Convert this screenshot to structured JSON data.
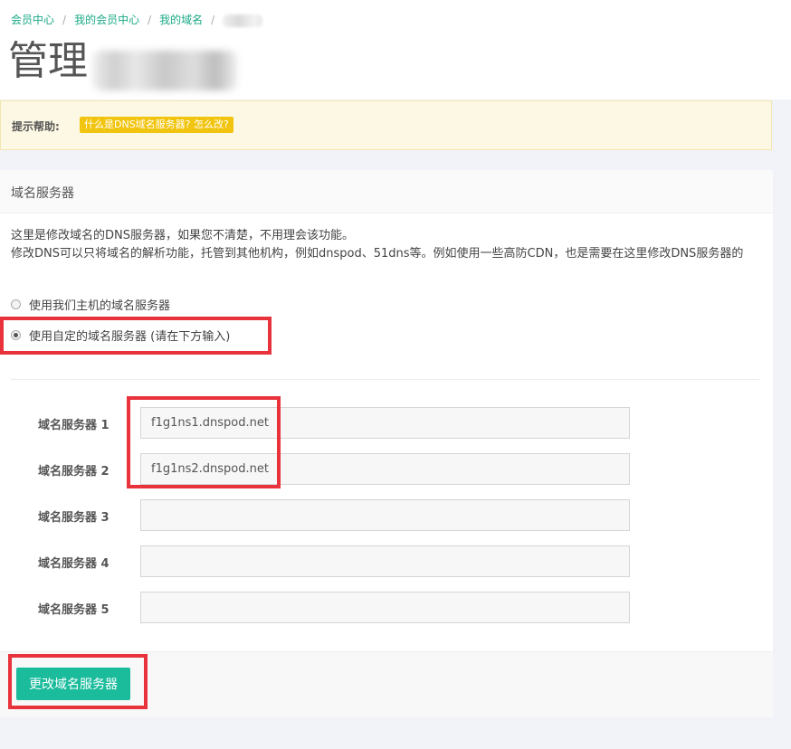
{
  "breadcrumb": {
    "items": [
      "会员中心",
      "我的会员中心",
      "我的域名"
    ]
  },
  "page": {
    "title": "管理"
  },
  "help": {
    "label": "提示帮助:",
    "badge": "什么是DNS域名服务器? 怎么改?"
  },
  "panel": {
    "title": "域名服务器",
    "desc_line1": "这里是修改域名的DNS服务器，如果您不清楚，不用理会该功能。",
    "desc_line2": "修改DNS可以只将域名的解析功能，托管到其他机构，例如dnspod、51dns等。例如使用一些高防CDN，也是需要在这里修改DNS服务器的",
    "radio_default": "使用我们主机的域名服务器",
    "radio_custom": "使用自定的域名服务器 (请在下方输入)",
    "selected": "custom"
  },
  "nameservers": [
    {
      "label": "域名服务器 1",
      "value": "f1g1ns1.dnspod.net"
    },
    {
      "label": "域名服务器 2",
      "value": "f1g1ns2.dnspod.net"
    },
    {
      "label": "域名服务器 3",
      "value": ""
    },
    {
      "label": "域名服务器 4",
      "value": ""
    },
    {
      "label": "域名服务器 5",
      "value": ""
    }
  ],
  "submit_label": "更改域名服务器",
  "colors": {
    "accent": "#1abc9c",
    "link": "#1aa987",
    "help_badge": "#f1c40f",
    "help_bg": "#fcf8e3",
    "annotation": "#e8323c"
  }
}
